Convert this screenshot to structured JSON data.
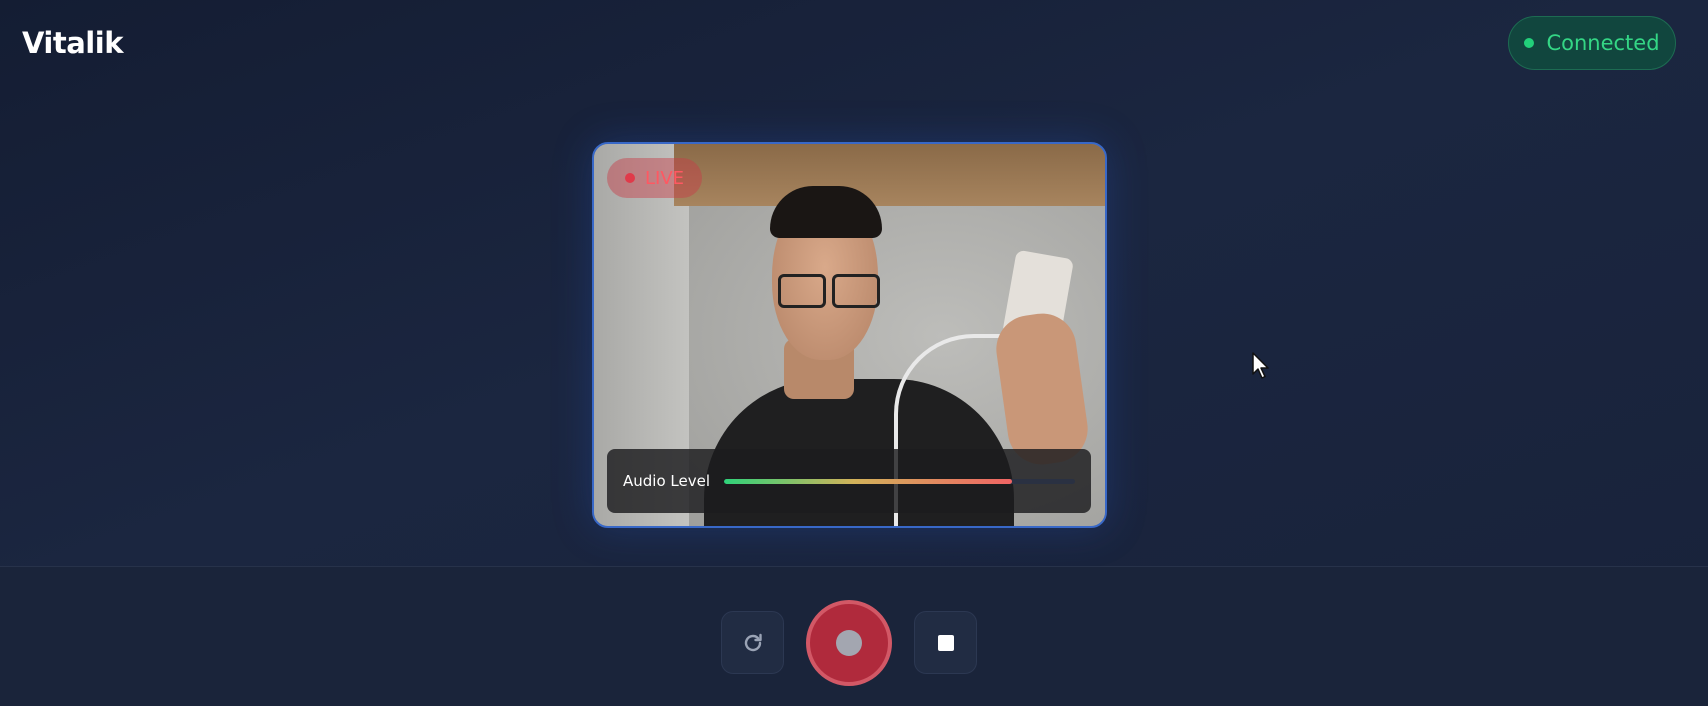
{
  "header": {
    "app_title": "Vitalik",
    "status": {
      "label": "Connected",
      "color": "#22d07a"
    }
  },
  "video": {
    "live_badge": "LIVE",
    "audio": {
      "label": "Audio Level",
      "level_percent": 82
    }
  },
  "controls": {
    "reset_icon": "refresh-icon",
    "record_icon": "record-icon",
    "stop_icon": "stop-icon",
    "record_color": "#b02a3c"
  }
}
